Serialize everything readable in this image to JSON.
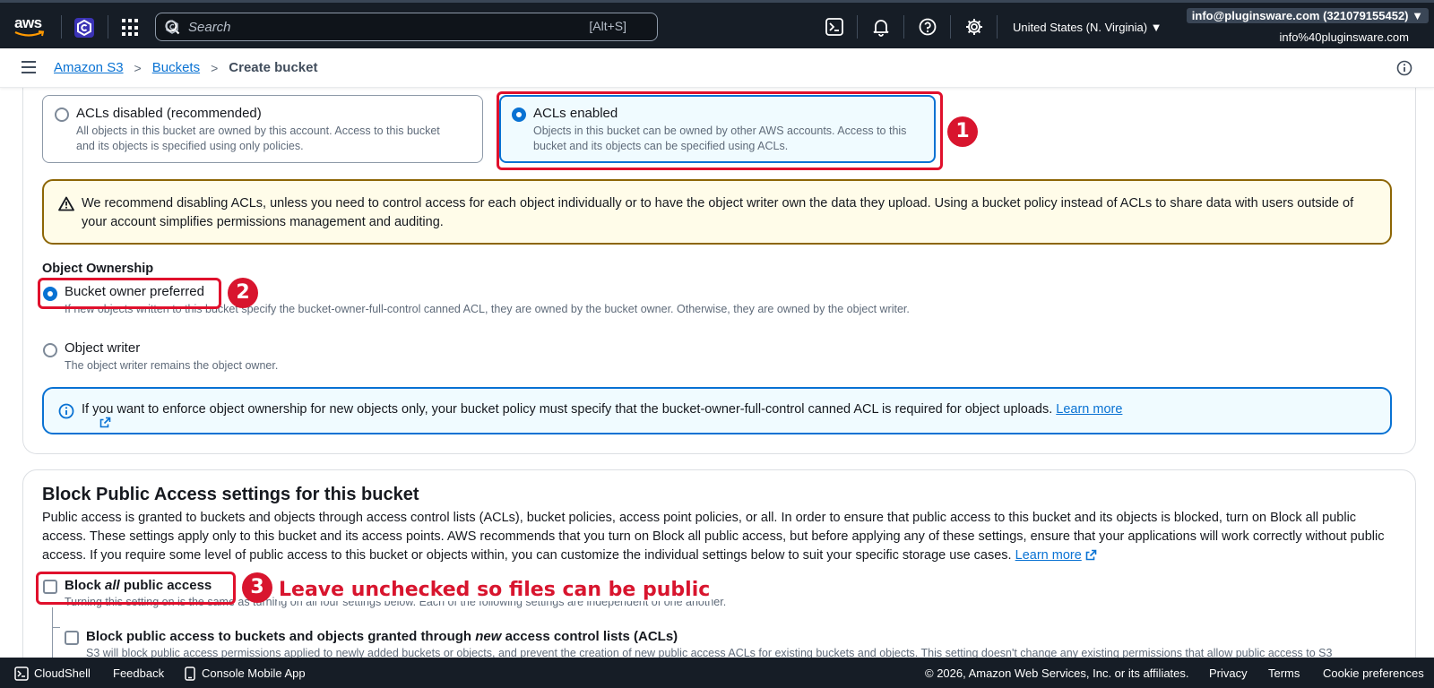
{
  "topnav": {
    "logo_text": "aws",
    "search_placeholder": "Search",
    "search_shortcut": "[Alt+S]",
    "region": "United States (N. Virginia) ▼",
    "account": "info@pluginsware.com (321079155452) ▼",
    "user": "info%40pluginsware.com"
  },
  "breadcrumb": {
    "items": [
      "Amazon S3",
      "Buckets"
    ],
    "current": "Create bucket"
  },
  "acl": {
    "option_disabled": {
      "title": "ACLs disabled (recommended)",
      "desc": "All objects in this bucket are owned by this account. Access to this bucket and its objects is specified using only policies."
    },
    "option_enabled": {
      "title": "ACLs enabled",
      "desc": "Objects in this bucket can be owned by other AWS accounts. Access to this bucket and its objects can be specified using ACLs."
    },
    "warning": "We recommend disabling ACLs, unless you need to control access for each object individually or to have the object writer own the data they upload. Using a bucket policy instead of ACLs to share data with users outside of your account simplifies permissions management and auditing."
  },
  "ownership": {
    "label": "Object Ownership",
    "bucket_owner": {
      "title": "Bucket owner preferred",
      "desc": "If new objects written to this bucket specify the bucket-owner-full-control canned ACL, they are owned by the bucket owner. Otherwise, they are owned by the object writer."
    },
    "object_writer": {
      "title": "Object writer",
      "desc": "The object writer remains the object owner."
    },
    "info": "If you want to enforce object ownership for new objects only, your bucket policy must specify that the bucket-owner-full-control canned ACL is required for object uploads.",
    "learn_more": "Learn more"
  },
  "block_public": {
    "heading": "Block Public Access settings for this bucket",
    "paragraph": "Public access is granted to buckets and objects through access control lists (ACLs), bucket policies, access point policies, or all. In order to ensure that public access to this bucket and its objects is blocked, turn on Block all public access. These settings apply only to this bucket and its access points. AWS recommends that you turn on Block all public access, but before applying any of these settings, ensure that your applications will work correctly without public access. If you require some level of public access to this bucket or objects within, you can customize the individual settings below to suit your specific storage use cases.",
    "learn_more": "Learn more",
    "block_all_pre": "Block ",
    "block_all_em": "all",
    "block_all_post": " public access",
    "block_all_desc": "Turning this setting on is the same as turning on all four settings below. Each of the following settings are independent of one another.",
    "block_new_pre": "Block public access to buckets and objects granted through ",
    "block_new_em": "new",
    "block_new_post": " access control lists (ACLs)",
    "block_new_desc": "S3 will block public access permissions applied to newly added buckets or objects, and prevent the creation of new public access ACLs for existing buckets and objects. This setting doesn't change any existing permissions that allow public access to S3"
  },
  "annotations": {
    "badge1": "1",
    "badge2": "2",
    "badge3": "3",
    "note3": "Leave unchecked so files can be public"
  },
  "footer": {
    "cloudshell": "CloudShell",
    "feedback": "Feedback",
    "mobile_app": "Console Mobile App",
    "copyright": "© 2026, Amazon Web Services, Inc. or its affiliates.",
    "privacy": "Privacy",
    "terms": "Terms",
    "cookies": "Cookie preferences"
  },
  "colors": {
    "nav_bg": "#161d26",
    "link": "#0972d3",
    "annotation_red": "#e0102c",
    "warning_border": "#8d6605"
  }
}
